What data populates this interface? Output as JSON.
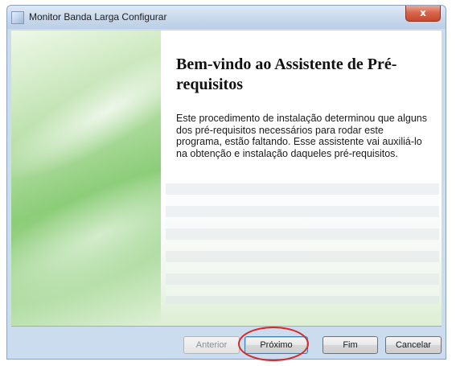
{
  "window": {
    "title": "Monitor Banda Larga Configurar",
    "close_label": "x"
  },
  "wizard": {
    "heading": "Bem-vindo ao Assistente de Pré-requisitos",
    "description": "Este procedimento de instalação determinou que alguns dos pré-requisitos necessários para rodar este programa, estão faltando. Esse assistente vai auxiliá-lo na obtenção e instalação daqueles pré-requisitos."
  },
  "buttons": {
    "previous": "Anterior",
    "next": "Próximo",
    "finish": "Fim",
    "cancel": "Cancelar"
  },
  "colors": {
    "highlight": "#d62a2a",
    "close_button": "#c6472c"
  }
}
